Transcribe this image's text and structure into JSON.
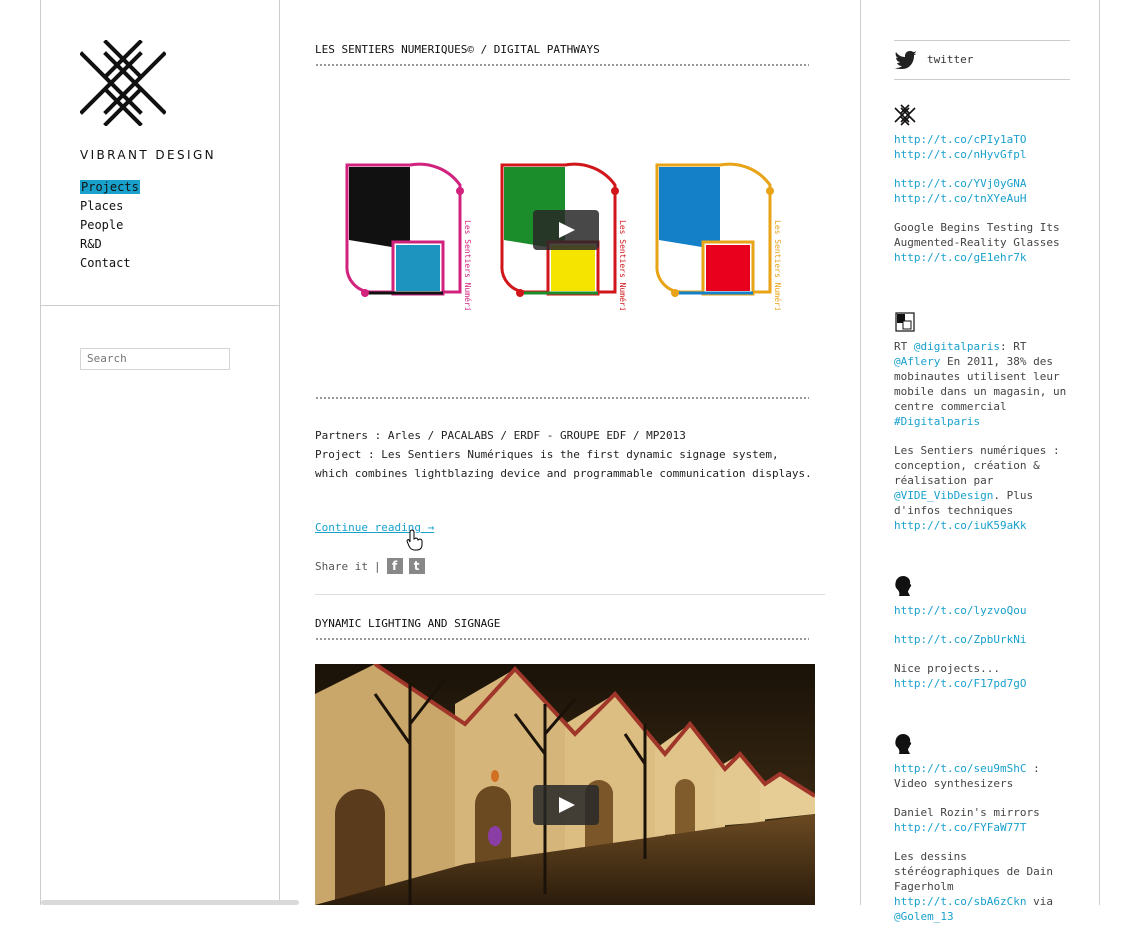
{
  "site": {
    "brand": "VIBRANT DESIGN",
    "accent_color": "#19a1cc"
  },
  "nav": {
    "items": [
      {
        "label": "Projects",
        "active": true
      },
      {
        "label": "Places",
        "active": false
      },
      {
        "label": "People",
        "active": false
      },
      {
        "label": "R&D",
        "active": false
      },
      {
        "label": "Contact",
        "active": false
      }
    ]
  },
  "search": {
    "placeholder": "Search"
  },
  "posts": [
    {
      "title": "LES SENTIERS NUMERIQUES© / DIGITAL PATHWAYS",
      "figure_label": "Les Sentiers Numériques",
      "partners": "Partners : Arles / PACALABS / ERDF - GROUPE EDF / MP2013",
      "project": "Project : Les Sentiers Numériques is the first dynamic signage system, which combines lightblazing device and programmable communication displays.",
      "continue": "Continue reading →",
      "share_label": "Share it",
      "share_sep": "|"
    },
    {
      "title": "DYNAMIC LIGHTING AND SIGNAGE"
    }
  ],
  "twitter": {
    "label": "twitter",
    "tweets": [
      {
        "avatar": "xx-logo-icon",
        "paras": [
          [
            "http://t.co/cPIy1aTO",
            "http://t.co/nHyvGfpl"
          ],
          [
            "http://t.co/YVj0yGNA",
            "http://t.co/tnXYeAuH"
          ],
          [
            "Google Begins Testing Its Augmented-Reality Glasses",
            "http://t.co/gE1ehr7k"
          ]
        ]
      },
      {
        "avatar": "square-logo-icon",
        "paras": [
          [
            "RT ",
            "@digitalparis",
            ": RT ",
            "@Aflery",
            " En 2011, 38% des mobinautes utilisent leur mobile dans un magasin, un centre commercial ",
            "#Digitalparis"
          ],
          [
            "Les Sentiers numériques : conception, création & réalisation par ",
            "@VIDE_VibDesign",
            ". Plus d'infos techniques ",
            "http://t.co/iuK59aKk"
          ]
        ]
      },
      {
        "avatar": "profile-silhouette-icon",
        "paras": [
          [
            "http://t.co/lyzvoQou"
          ],
          [
            "http://t.co/ZpbUrkNi"
          ],
          [
            "Nice projects...",
            "http://t.co/F17pd7gO"
          ]
        ]
      },
      {
        "avatar": "profile-silhouette-icon",
        "paras": [
          [
            "http://t.co/seu9mShC",
            " : Video synthesizers"
          ],
          [
            "Daniel Rozin's mirrors ",
            "http://t.co/FYFaW77T"
          ],
          [
            "Les dessins stéréographiques de Dain Fagerholm ",
            "http://t.co/sbA6zCkn",
            " via ",
            "@Golem_13"
          ]
        ]
      }
    ]
  }
}
